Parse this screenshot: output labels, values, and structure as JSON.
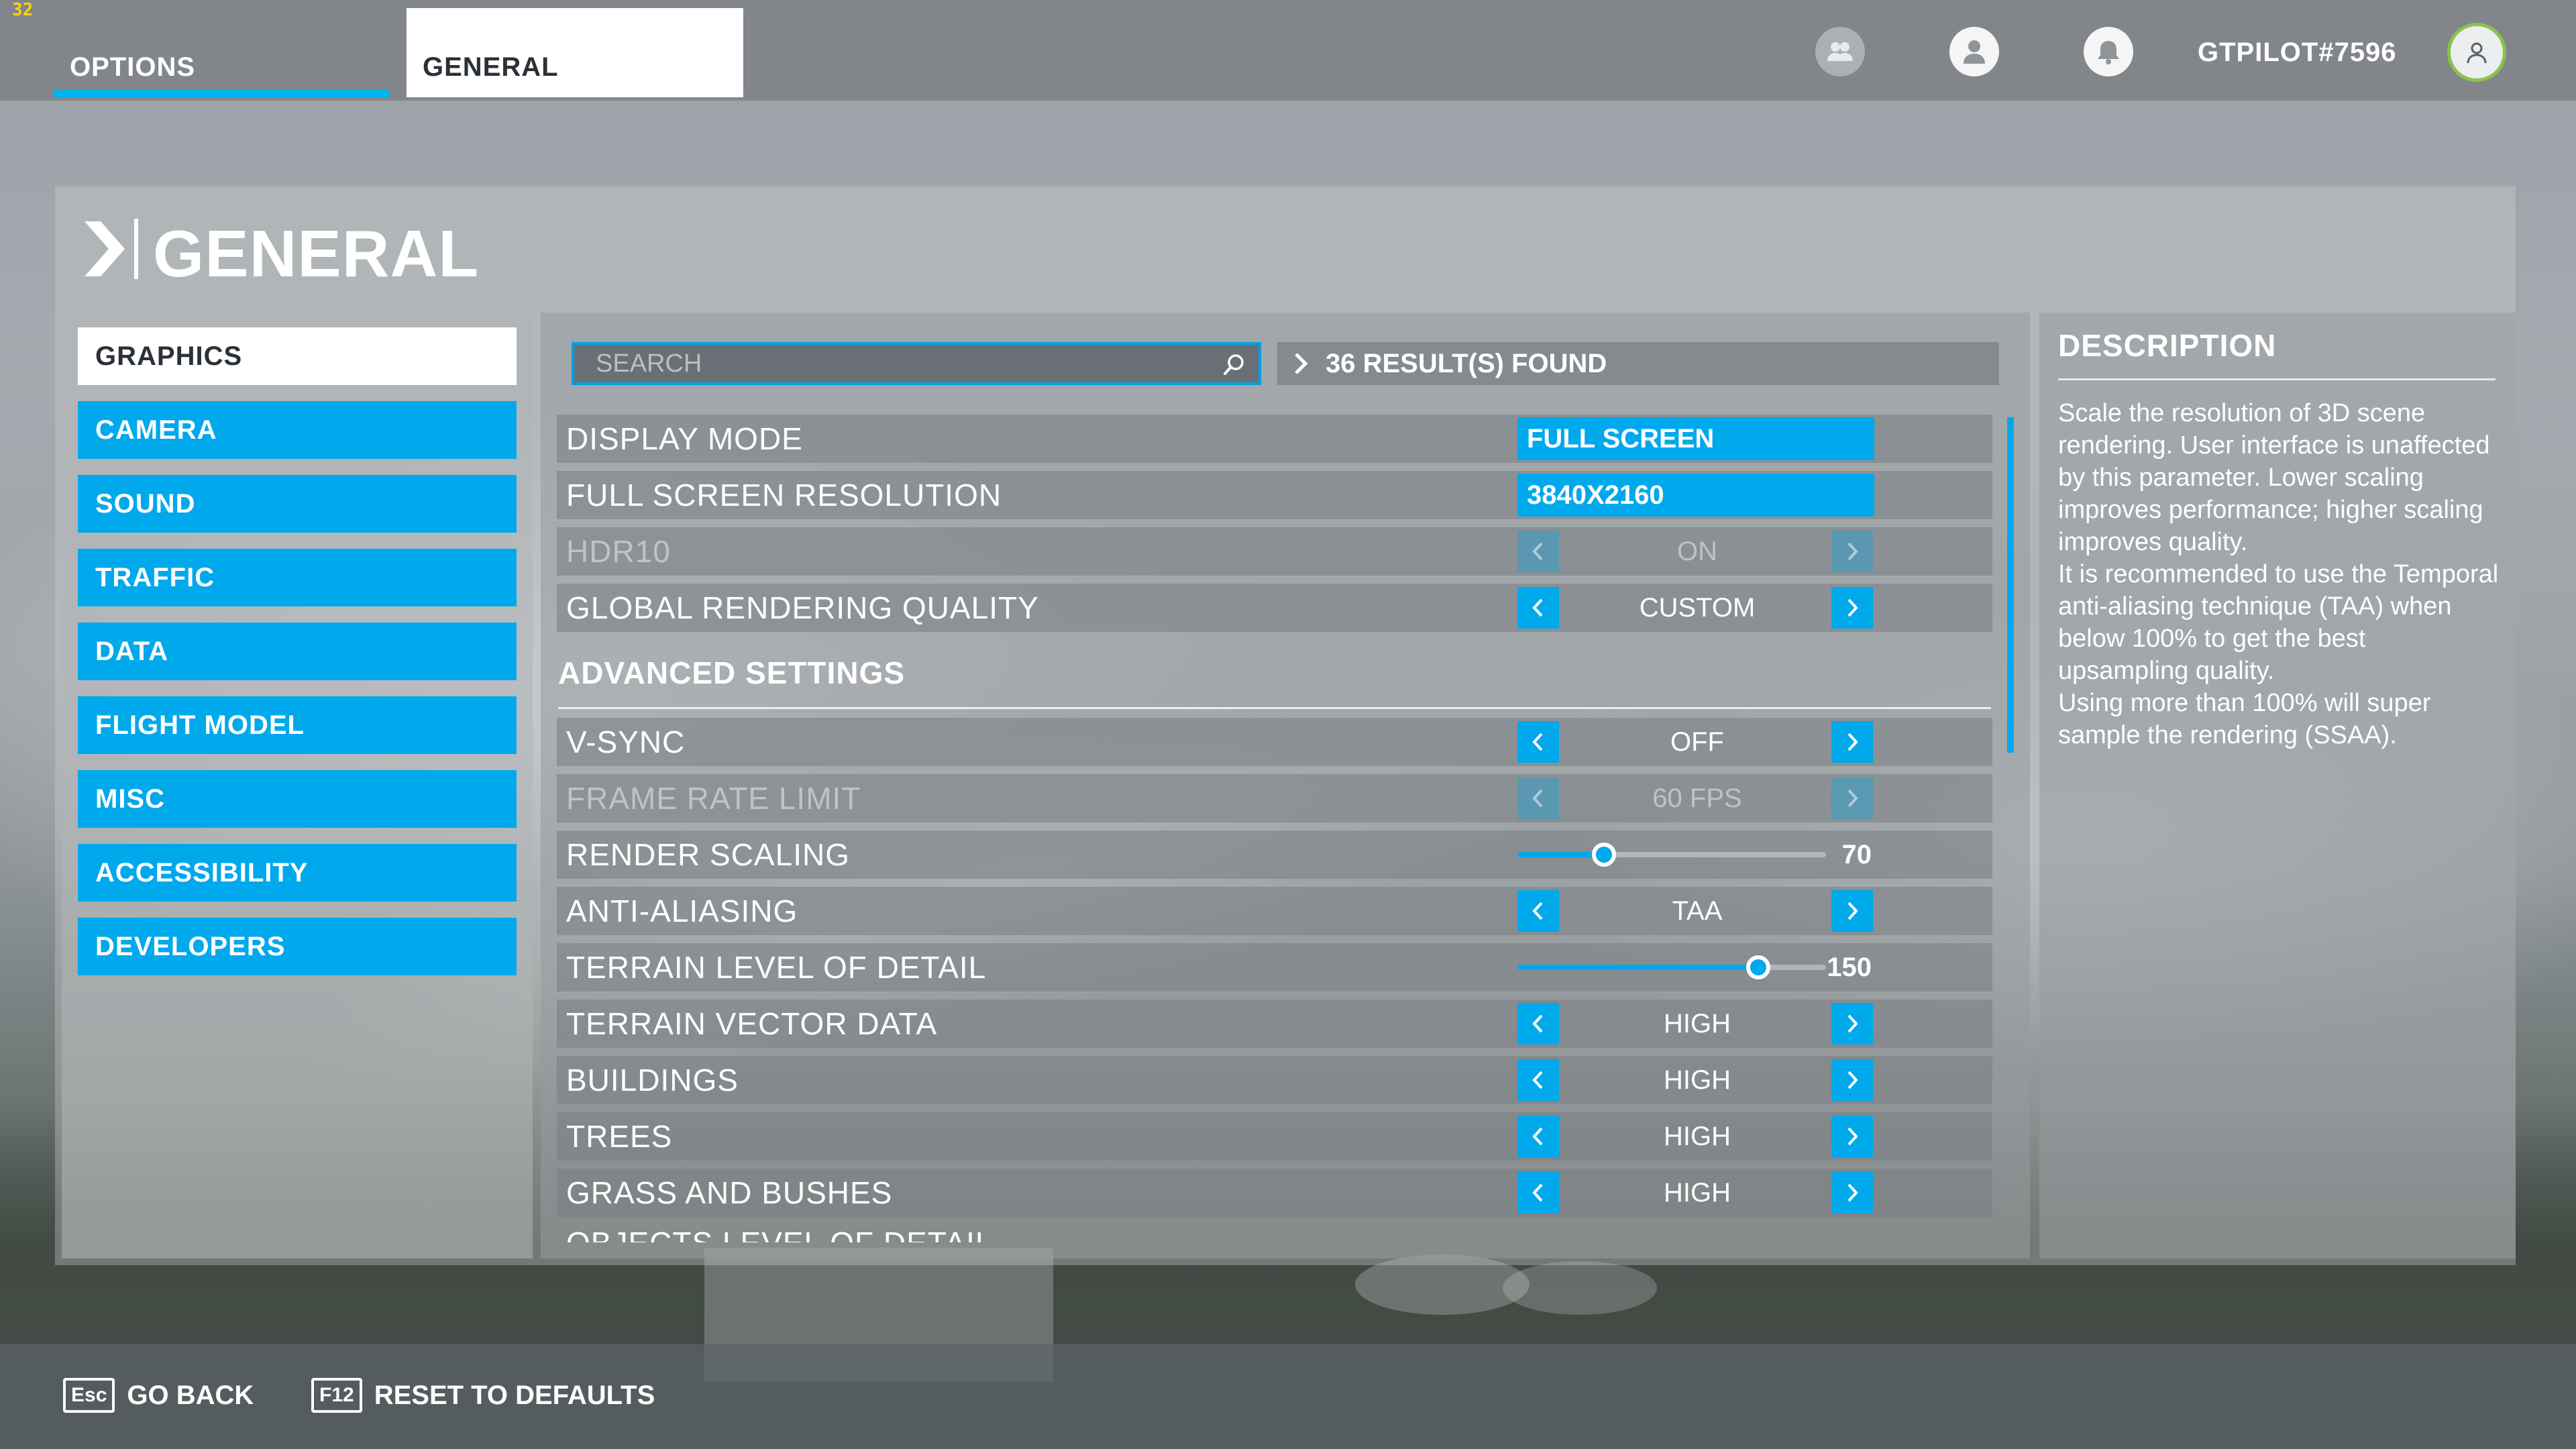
{
  "hud": {
    "fps_counter": "32"
  },
  "topbar": {
    "tabs": [
      {
        "label": "OPTIONS"
      },
      {
        "label": "GENERAL"
      }
    ],
    "username": "GTPILOT#7596"
  },
  "header": {
    "title": "GENERAL"
  },
  "nav": {
    "items": [
      {
        "label": "GRAPHICS",
        "active": true
      },
      {
        "label": "CAMERA"
      },
      {
        "label": "SOUND"
      },
      {
        "label": "TRAFFIC"
      },
      {
        "label": "DATA"
      },
      {
        "label": "FLIGHT MODEL"
      },
      {
        "label": "MISC"
      },
      {
        "label": "ACCESSIBILITY"
      },
      {
        "label": "DEVELOPERS"
      }
    ]
  },
  "search": {
    "placeholder": "SEARCH",
    "results": "36 RESULT(S) FOUND"
  },
  "settings": {
    "display_mode": {
      "label": "DISPLAY MODE",
      "value": "FULL SCREEN"
    },
    "resolution": {
      "label": "FULL SCREEN RESOLUTION",
      "value": "3840X2160"
    },
    "hdr10": {
      "label": "HDR10",
      "value": "ON",
      "enabled": false
    },
    "global_quality": {
      "label": "GLOBAL RENDERING QUALITY",
      "value": "CUSTOM"
    },
    "advanced_title": "ADVANCED SETTINGS",
    "vsync": {
      "label": "V-SYNC",
      "value": "OFF"
    },
    "frame_rate_limit": {
      "label": "FRAME RATE LIMIT",
      "value": "60 FPS",
      "enabled": false
    },
    "render_scaling": {
      "label": "RENDER SCALING",
      "value": "70",
      "fraction": 0.28
    },
    "anti_aliasing": {
      "label": "ANTI-ALIASING",
      "value": "TAA"
    },
    "terrain_lod": {
      "label": "TERRAIN LEVEL OF DETAIL",
      "value": "150",
      "fraction": 0.78
    },
    "terrain_vector": {
      "label": "TERRAIN VECTOR DATA",
      "value": "HIGH"
    },
    "buildings": {
      "label": "BUILDINGS",
      "value": "HIGH"
    },
    "trees": {
      "label": "TREES",
      "value": "HIGH"
    },
    "grass": {
      "label": "GRASS AND BUSHES",
      "value": "HIGH"
    },
    "objects_lod": {
      "label": "OBJECTS LEVEL OF DETAIL"
    }
  },
  "description": {
    "title": "DESCRIPTION",
    "paragraphs": [
      "Scale the resolution of 3D scene rendering. User interface is unaffected by this parameter. Lower scaling improves performance; higher scaling improves quality.",
      "It is recommended to use the Temporal anti-aliasing technique (TAA) when below 100% to get the best upsampling quality.",
      "Using more than 100% will super sample the rendering (SSAA)."
    ]
  },
  "footer": {
    "back": {
      "key": "Esc",
      "label": "GO BACK"
    },
    "reset": {
      "key": "F12",
      "label": "RESET TO DEFAULTS"
    }
  },
  "colors": {
    "accent": "#00a8ec",
    "avatar_ring": "#8bc34a",
    "fps": "#ffd400"
  },
  "icons": [
    "friends-icon",
    "profile-icon",
    "notification-icon",
    "avatar-icon",
    "search-icon",
    "chevron-right-icon",
    "chevron-left-icon"
  ]
}
